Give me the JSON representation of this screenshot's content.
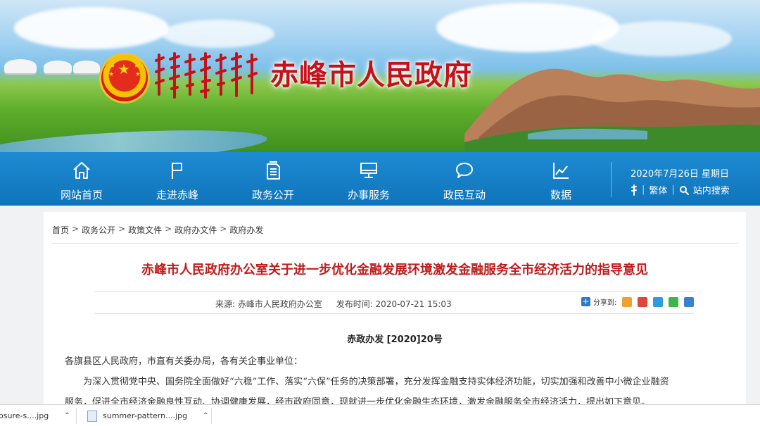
{
  "header": {
    "site_title": "赤峰市人民政府"
  },
  "nav": {
    "items": [
      {
        "label": "网站首页",
        "icon": "home-icon"
      },
      {
        "label": "走进赤峰",
        "icon": "flag-icon"
      },
      {
        "label": "政务公开",
        "icon": "document-icon"
      },
      {
        "label": "办事服务",
        "icon": "monitor-icon"
      },
      {
        "label": "政民互动",
        "icon": "chat-bubble-icon"
      },
      {
        "label": "数据",
        "icon": "line-chart-icon"
      }
    ],
    "date": "2020年7月26日 星期日",
    "traditional_label": "繁体",
    "search_label": "站内搜索"
  },
  "breadcrumb": [
    "首页",
    "政务公开",
    "政策文件",
    "政府办文件",
    "政府办发"
  ],
  "article": {
    "title": "赤峰市人民政府办公室关于进一步优化金融发展环境激发金融服务全市经济活力的指导意见",
    "source": "来源:  赤峰市人民政府办公室",
    "published": "发布时间:  2020-07-21 15:03",
    "share_label": "分享到:",
    "doc_number": "赤政办发 [2020]20号",
    "addressee": "各旗县区人民政府，市直有关委办局，各有关企事业单位：",
    "para1_line1": "为深入贯彻党中央、国务院全面做好“六稳”工作、落实“六保”任务的决策部署，充分发挥金融支持实体经济功能，切实加强和改善中小微企业融资",
    "para1_line2": "服务，促进全市经济金融良性互动、协调健康发展，经市政府同意，现就进一步优化金融生态环境，激发金融服务全市经济活力，提出如下意见。"
  },
  "downloads": [
    {
      "name": "osure-s....jpg"
    },
    {
      "name": "summer-pattern....jpg"
    }
  ],
  "colors": {
    "nav_blue": "#1580c6",
    "title_red": "#c4121a",
    "article_title_red": "#c01b1b"
  }
}
